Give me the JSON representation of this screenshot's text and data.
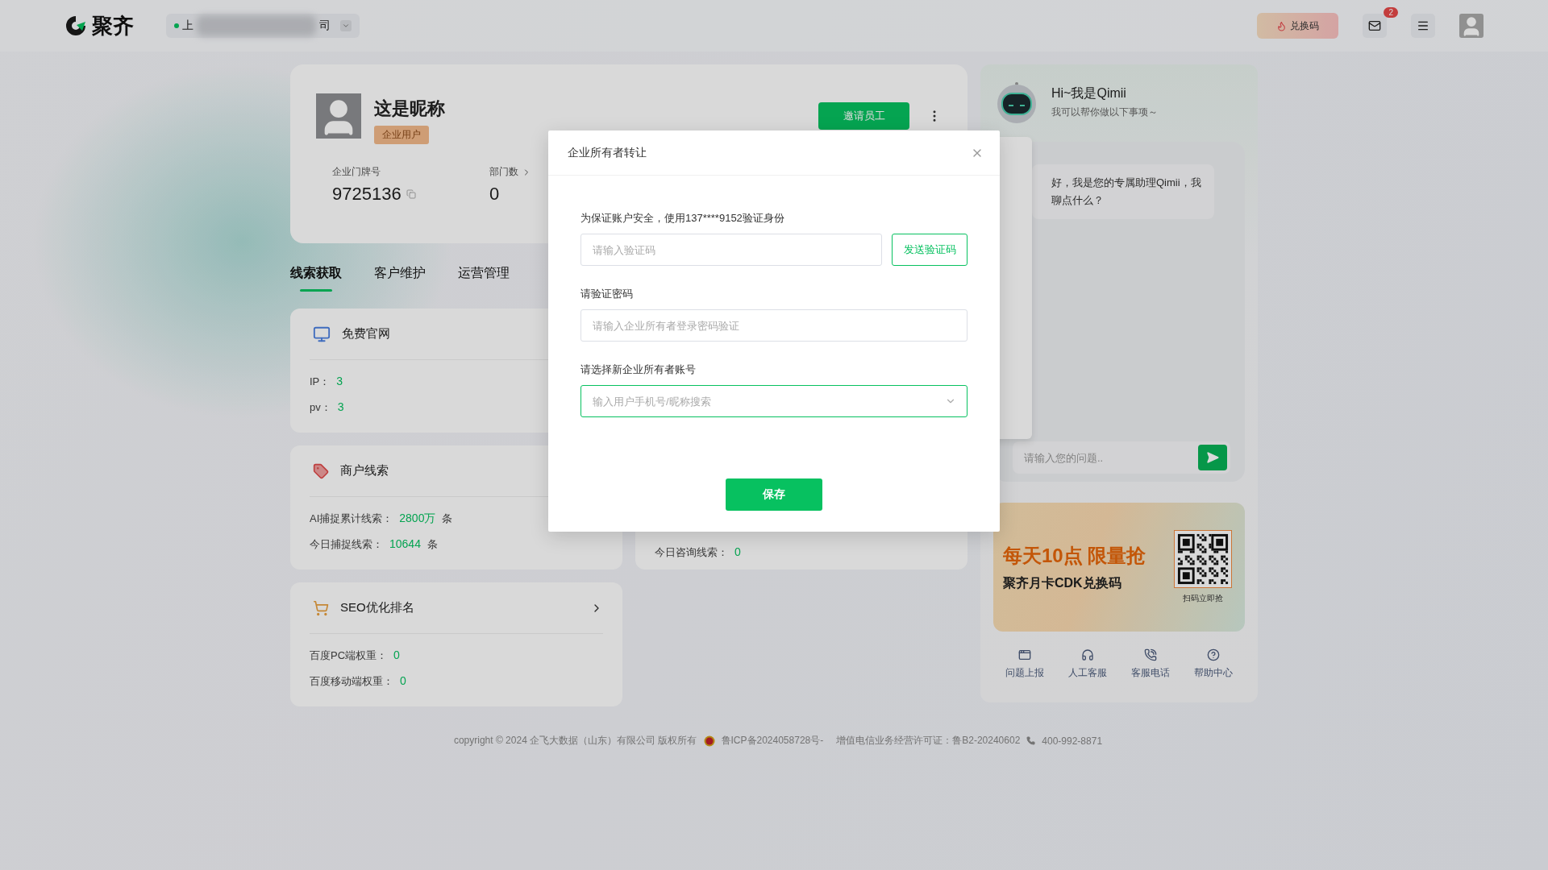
{
  "top_bar": {
    "logo": "聚齐",
    "company": {
      "start": "上",
      "end": "司"
    },
    "redeem_button": "兑换码",
    "mail_badge": "2"
  },
  "profile": {
    "name": "这是昵称",
    "badge": "企业用户",
    "stats": [
      {
        "label": "企业门牌号",
        "value": "9725136",
        "kind": "copy"
      },
      {
        "label": "部门数",
        "value": "0",
        "kind": "link"
      }
    ],
    "invite_button": "邀请员工"
  },
  "tabs": [
    {
      "label": "线索获取",
      "selected": true
    },
    {
      "label": "客户维护",
      "selected": false
    },
    {
      "label": "运营管理",
      "selected": false
    }
  ],
  "cards": [
    {
      "kind": "monitor",
      "title": "免费官网",
      "rows": [
        {
          "label": "IP：",
          "value": "3"
        },
        {
          "label": "pv：",
          "value": "3"
        }
      ]
    },
    {
      "kind": "tag",
      "title": "商户线索",
      "rows": [
        {
          "label": "AI捕捉累计线索：",
          "value": "2800万",
          "unit": "条"
        },
        {
          "label": "今日捕捉线索：",
          "value": "10644",
          "unit": "条"
        }
      ]
    },
    {
      "kind": "cart",
      "title": "SEO优化排名",
      "has_arrow": true,
      "rows": [
        {
          "label": "百度PC端权重：",
          "value": "0"
        },
        {
          "label": "百度移动端权重：",
          "value": "0"
        }
      ]
    }
  ],
  "consult_card": {
    "rows": [
      {
        "label": "今日咨询线索：",
        "value": "0"
      }
    ]
  },
  "modal": {
    "title": "企业所有者转让",
    "fields": [
      {
        "kind": "code",
        "label": "为保证账户安全，使用137****9152验证身份",
        "placeholder": "请输入验证码",
        "button": "发送验证码",
        "focused": false
      },
      {
        "kind": "text",
        "label": "请验证密码",
        "placeholder": "请输入企业所有者登录密码验证",
        "focused": false
      },
      {
        "kind": "select",
        "label": "请选择新企业所有者账号",
        "placeholder": "输入用户手机号/昵称搜索",
        "focused": true
      }
    ],
    "save_button": "保存"
  },
  "assistant": {
    "greeting": "Hi~我是Qimii",
    "subtitle": "我可以帮你做以下事项～",
    "message_lines": [
      "好，我是您的专属助理Qimii，我",
      "聊点什么？"
    ],
    "input_placeholder": "请输入您的问题..",
    "banner": {
      "headline": "每天10点 限量抢",
      "subline": "聚齐月卡CDK兑换码",
      "qr_caption": "扫码立即抢"
    },
    "shortcuts": [
      {
        "kind": "report",
        "label": "问题上报"
      },
      {
        "kind": "headset",
        "label": "人工客服"
      },
      {
        "kind": "phone",
        "label": "客服电话"
      },
      {
        "kind": "help",
        "label": "帮助中心"
      }
    ]
  },
  "footer": {
    "copyright": "copyright © 2024 企飞大数据（山东）有限公司 版权所有",
    "icp": "鲁ICP备2024058728号-",
    "license": "增值电信业务经营许可证：鲁B2-20240602",
    "phone": "400-992-8871"
  }
}
